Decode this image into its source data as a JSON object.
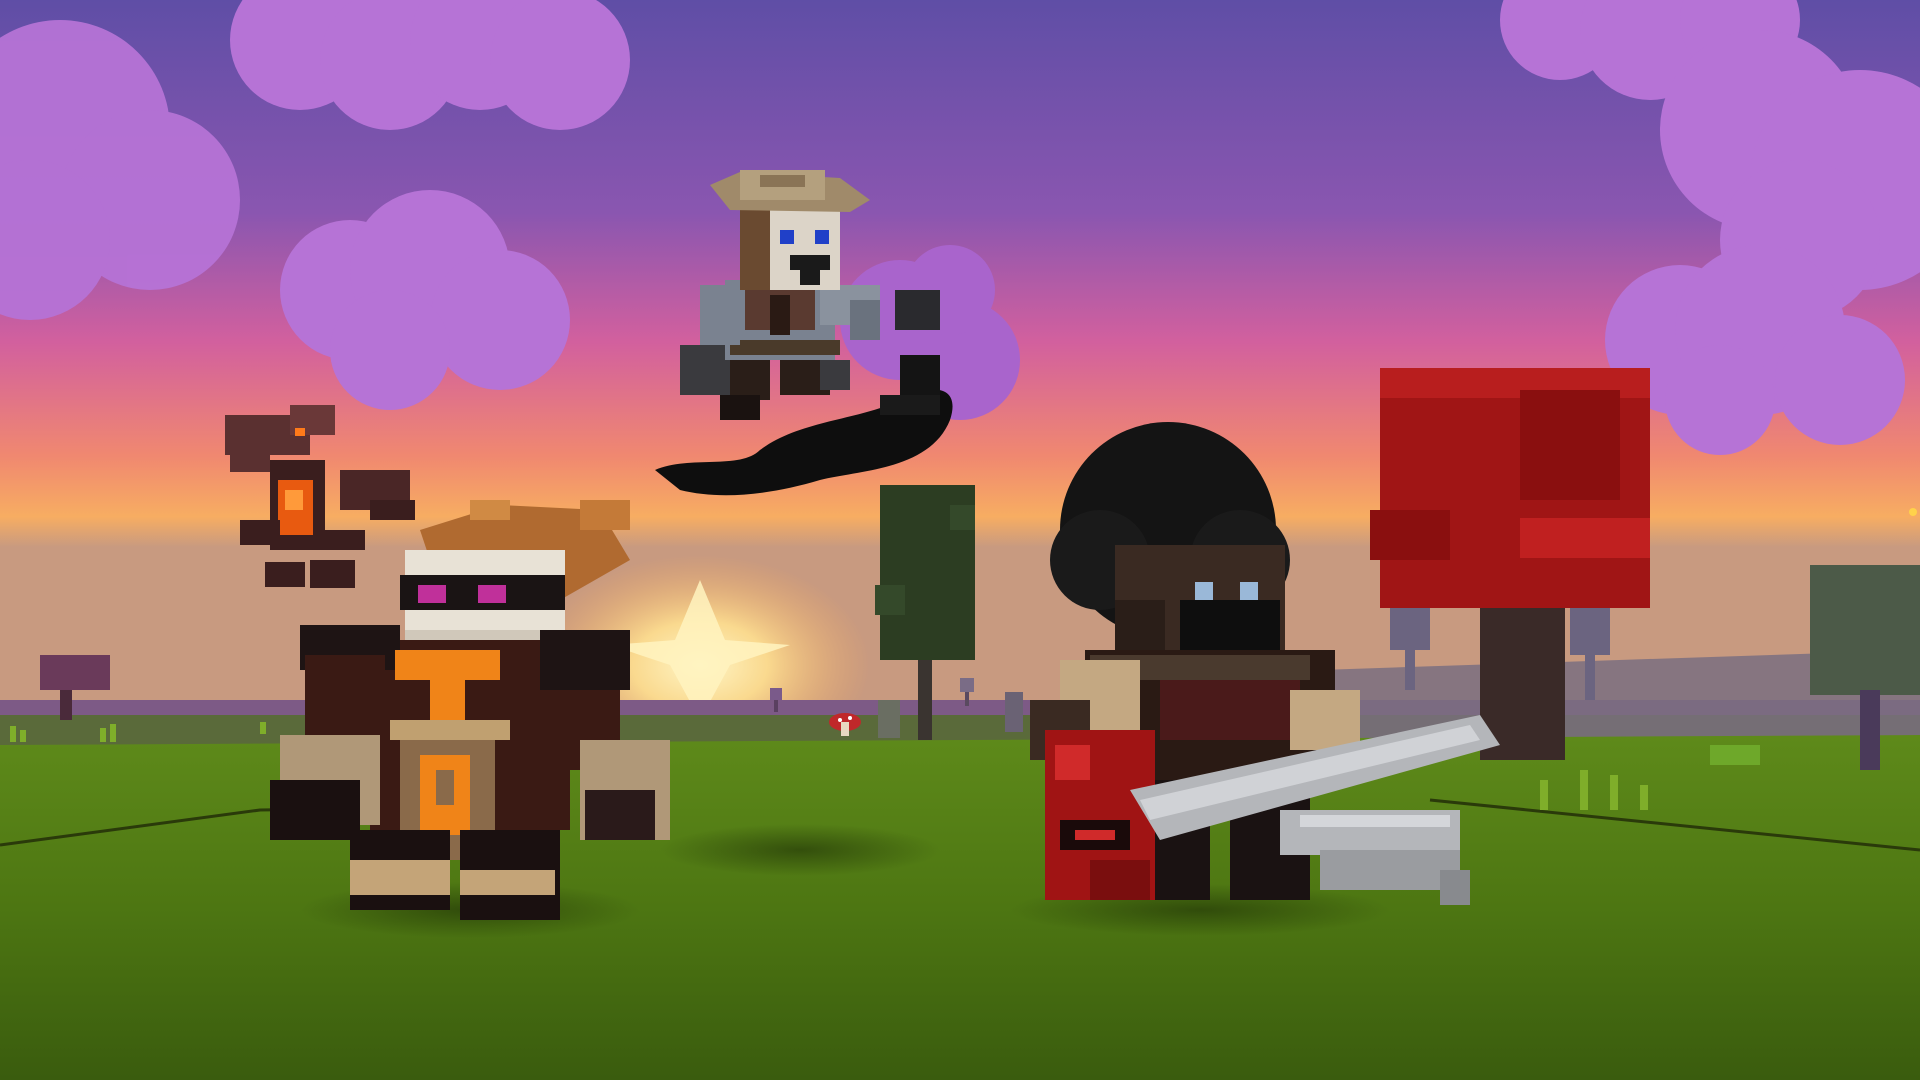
{
  "scene": {
    "type": "voxel-game-screenshot",
    "time_of_day": "sunset",
    "colors": {
      "sky_top": "#6b52a8",
      "sky_mid": "#c860a8",
      "sky_horizon": "#f7a25a",
      "sun_glow": "#ffe9a0",
      "cloud": "#b878d8",
      "cloud_shadow": "#8e5cc4",
      "grass_top": "#5f8a1c",
      "grass_bottom": "#3f6410",
      "tree_red": "#a01414",
      "tree_green": "#2e3d22",
      "tree_purple": "#6a3a5a"
    },
    "characters": [
      {
        "name": "knight-with-orange-tabard",
        "position": "front-left"
      },
      {
        "name": "dragon-pet",
        "position": "left-air"
      },
      {
        "name": "pirate-on-shadow-wave",
        "position": "center-air"
      },
      {
        "name": "afro-warrior-with-sword",
        "position": "front-right"
      }
    ],
    "props": [
      {
        "name": "red-voxel-tree"
      },
      {
        "name": "green-voxel-tree"
      },
      {
        "name": "purple-voxel-tree"
      },
      {
        "name": "mushroom"
      }
    ]
  }
}
